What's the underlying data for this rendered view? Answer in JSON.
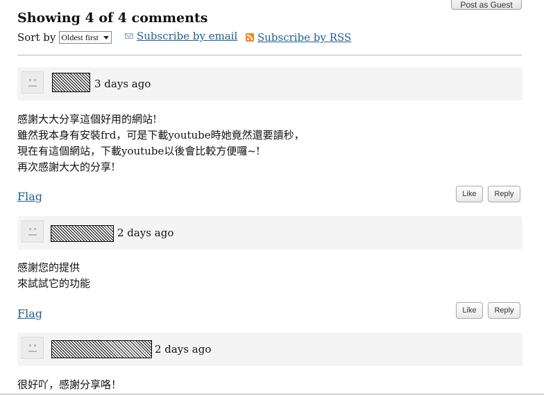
{
  "header": {
    "post_guest_label": "Post as Guest",
    "title": "Showing 4 of 4 comments",
    "sort_label": "Sort by",
    "sort_value": "Oldest first",
    "subscribe_email": "Subscribe by email",
    "subscribe_rss": "Subscribe by RSS"
  },
  "comments": [
    {
      "time": "3 days ago",
      "body": "感謝大大分享這個好用的網站!\n雖然我本身有安裝frd，可是下載youtube時她竟然還要讀秒，\n現在有這個網站，下載youtube以後會比較方便囉~!\n再次感謝大大的分享!",
      "flag": "Flag",
      "like": "Like",
      "reply": "Reply"
    },
    {
      "time": "2 days ago",
      "body": "感謝您的提供\n來試試它的功能",
      "flag": "Flag",
      "like": "Like",
      "reply": "Reply"
    },
    {
      "time": "2 days ago",
      "body": "很好吖，感謝分享咯！"
    }
  ],
  "icons": {
    "email": "mail-icon",
    "rss": "rss-icon",
    "avatar": "default-avatar-icon"
  },
  "colors": {
    "link": "#1f5f8f",
    "header_bg": "#f4f4f4",
    "rss": "#f08a24"
  }
}
